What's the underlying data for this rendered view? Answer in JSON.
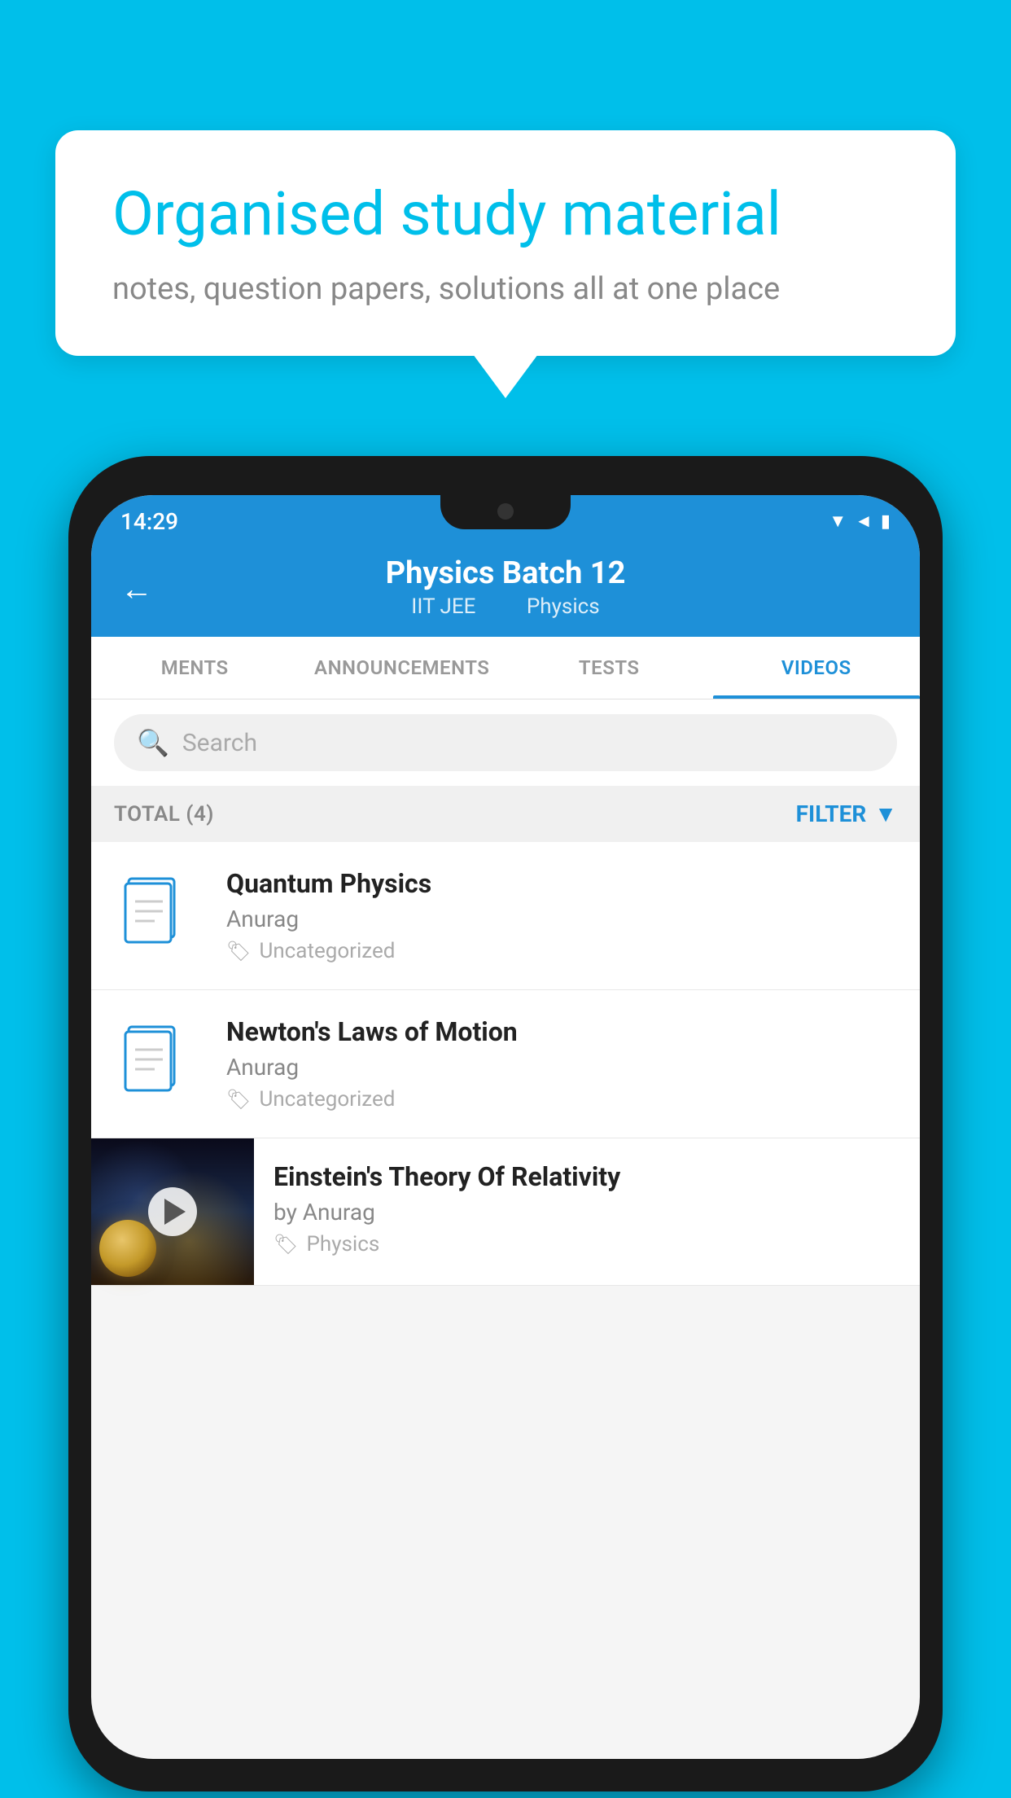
{
  "background_color": "#00BFEA",
  "bubble": {
    "title": "Organised study material",
    "subtitle": "notes, question papers, solutions all at one place"
  },
  "phone": {
    "status_bar": {
      "time": "14:29"
    },
    "header": {
      "back_label": "←",
      "title": "Physics Batch 12",
      "subtitle_part1": "IIT JEE",
      "subtitle_part2": "Physics"
    },
    "tabs": [
      {
        "label": "MENTS",
        "active": false
      },
      {
        "label": "ANNOUNCEMENTS",
        "active": false
      },
      {
        "label": "TESTS",
        "active": false
      },
      {
        "label": "VIDEOS",
        "active": true
      }
    ],
    "search": {
      "placeholder": "Search"
    },
    "filter_bar": {
      "total_label": "TOTAL (4)",
      "filter_label": "FILTER"
    },
    "videos": [
      {
        "id": "quantum",
        "title": "Quantum Physics",
        "author": "Anurag",
        "tag": "Uncategorized",
        "has_thumbnail": false
      },
      {
        "id": "newton",
        "title": "Newton's Laws of Motion",
        "author": "Anurag",
        "tag": "Uncategorized",
        "has_thumbnail": false
      },
      {
        "id": "einstein",
        "title": "Einstein's Theory Of Relativity",
        "author": "by Anurag",
        "tag": "Physics",
        "has_thumbnail": true
      }
    ]
  }
}
